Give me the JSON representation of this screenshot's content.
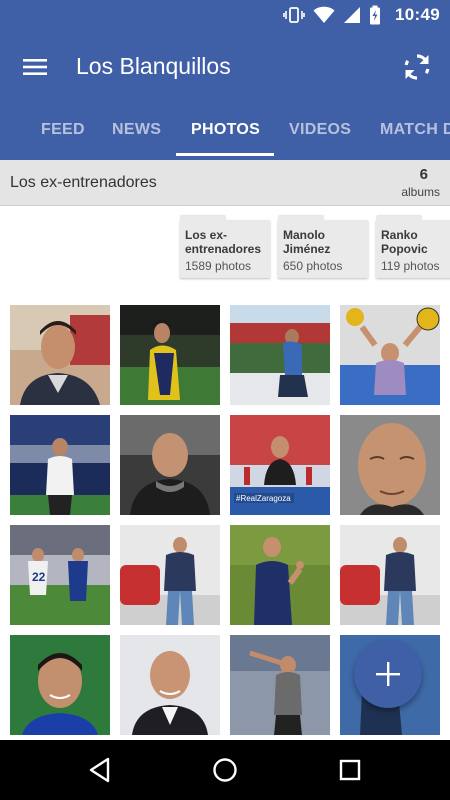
{
  "status_bar": {
    "time": "10:49"
  },
  "app_bar": {
    "title": "Los Blanquillos"
  },
  "tabs": [
    {
      "label": "FEED",
      "active": false
    },
    {
      "label": "NEWS",
      "active": false
    },
    {
      "label": "PHOTOS",
      "active": true
    },
    {
      "label": "VIDEOS",
      "active": false
    },
    {
      "label": "MATCH D",
      "active": false
    }
  ],
  "section": {
    "title": "Los ex-entrenadores",
    "album_count": "6",
    "album_count_label": "albums"
  },
  "albums": [
    {
      "name": "Los ex-entrenadores",
      "count": "1589 photos"
    },
    {
      "name": "Manolo Jiménez",
      "count": "650 photos"
    },
    {
      "name": "Ranko Popovic",
      "count": "119 photos"
    }
  ],
  "colors": {
    "primary": "#3f5fa6",
    "section_bg": "#e4e4e4",
    "card_bg": "#eaeaea"
  },
  "icons": {
    "menu": "hamburger-icon",
    "refresh": "refresh-icon",
    "fab": "plus-icon",
    "nav_back": "back-triangle-icon",
    "nav_home": "home-circle-icon",
    "nav_recents": "recents-square-icon"
  }
}
